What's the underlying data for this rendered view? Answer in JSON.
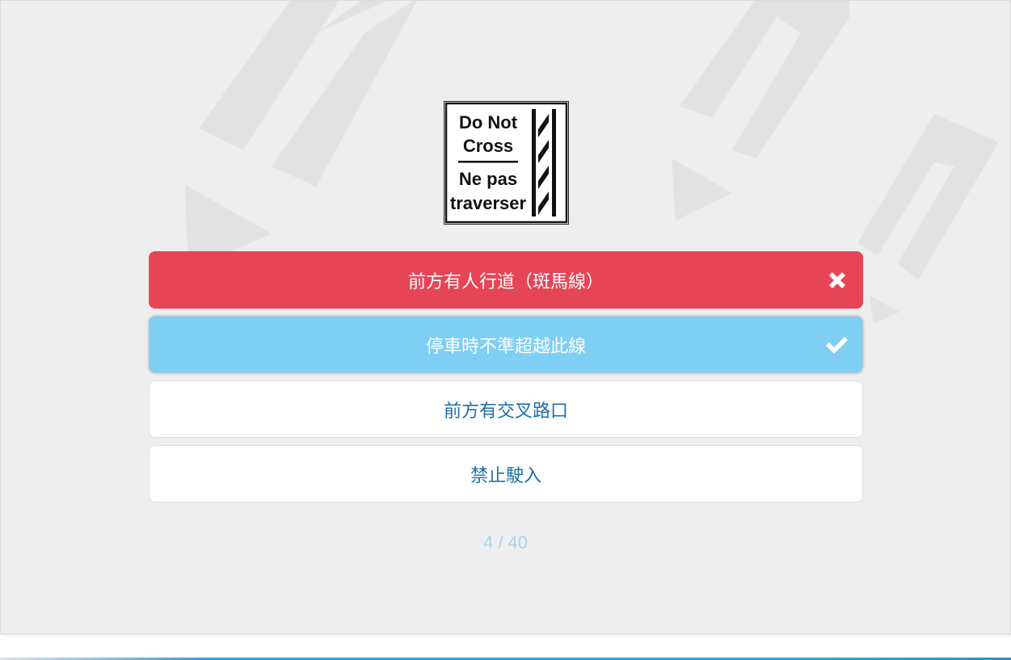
{
  "question": {
    "sign": {
      "icon": "do-not-cross-sign-icon",
      "line1": "Do  Not",
      "line2": "Cross",
      "line3": "Ne pas",
      "line4": "traverser"
    },
    "options": [
      {
        "label": "前方有人行道（斑馬線）",
        "state": "wrong",
        "icon": "close-icon"
      },
      {
        "label": "停車時不準超越此線",
        "state": "correct",
        "icon": "checkmark-icon"
      },
      {
        "label": "前方有交叉路口",
        "state": "unselected"
      },
      {
        "label": "禁止駛入",
        "state": "unselected"
      }
    ]
  },
  "progress": {
    "current": 4,
    "total": 40,
    "text": "4 / 40"
  },
  "colors": {
    "wrong": "#e64556",
    "correct": "#7fcef3",
    "option_text": "#1d6fa8",
    "progress_text": "#aed3ea",
    "card_background": "#eeeeee"
  }
}
